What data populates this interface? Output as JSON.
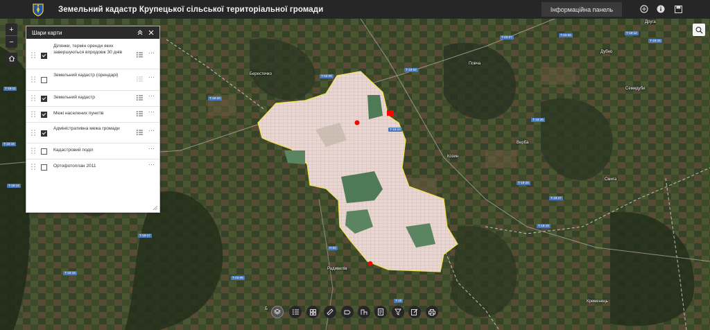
{
  "header": {
    "title": "Земельний кадастр Крупецької сільської територіальної громади",
    "info_panel_label": "Інформаційна панель",
    "icons": [
      "logo-emblem-icon",
      "view-toggle-icon",
      "info-icon",
      "save-icon"
    ]
  },
  "layers_panel": {
    "title": "Шари карти",
    "layers": [
      {
        "label": "Ділянки, термін оренди яких завершуються впродовж 30 днів",
        "checked": true,
        "legend": true,
        "legend_dim": false
      },
      {
        "label": "Земельний кадастр (орендарі)",
        "checked": false,
        "legend": true,
        "legend_dim": true
      },
      {
        "label": "Земельний кадастр",
        "checked": true,
        "legend": true,
        "legend_dim": false
      },
      {
        "label": "Межі населених пунктів",
        "checked": true,
        "legend": true,
        "legend_dim": false
      },
      {
        "label": "Адміністративна межа громади",
        "checked": true,
        "legend": true,
        "legend_dim": false
      },
      {
        "label": "Кадастровий поділ",
        "checked": false,
        "legend": false,
        "legend_dim": false
      },
      {
        "label": "Ортофотоплан 2011",
        "checked": false,
        "legend": false,
        "legend_dim": false
      }
    ]
  },
  "map": {
    "zoom_in": "+",
    "zoom_out": "−",
    "places": [
      "Друга",
      "Дубно",
      "Берестечко",
      "Повча",
      "Семидуби",
      "Вербa",
      "Козин",
      "Смига",
      "Радивилів",
      "Кременець",
      "Б"
    ],
    "roads": [
      "Т-03-05",
      "Т-03-07",
      "Т-18-02",
      "Т-03-09",
      "Т-18-11",
      "Т-18-20",
      "Т-18-23",
      "Т-18-25",
      "Т-18-26",
      "Т-18-27",
      "Н-02",
      "Т-18-17",
      "Т-18-18",
      "Т-03-08",
      "Т-18-19",
      "Т-20",
      "Т-18-12",
      "Т-18-15",
      "Т-18-16",
      "Т-18-14"
    ]
  },
  "toolbar": {
    "buttons": [
      "layers-icon",
      "legend-list-icon",
      "basemap-gallery-icon",
      "measure-icon",
      "bookmark-icon",
      "query-icon",
      "attribute-table-icon",
      "filter-icon",
      "edit-icon",
      "print-icon"
    ]
  },
  "colors": {
    "header_bg": "#262626",
    "boundary": "#f2e34c",
    "parcel_fill": "#e8d8d4",
    "expiring_parcel": "#ff0000"
  }
}
